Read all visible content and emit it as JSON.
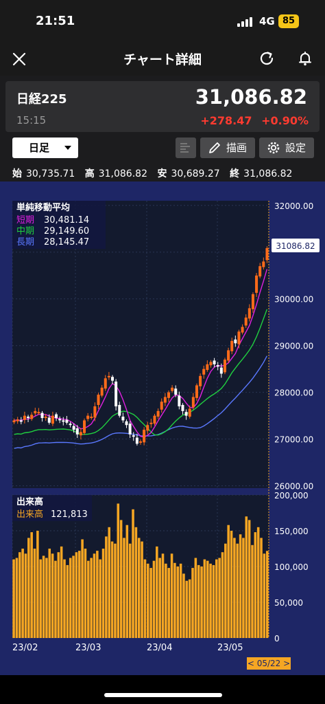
{
  "status_bar": {
    "time": "21:51",
    "network": "4G",
    "battery": "85"
  },
  "nav": {
    "title": "チャート詳細"
  },
  "quote": {
    "name": "日経225",
    "time": "15:15",
    "price": "31,086.82",
    "change": "+278.47",
    "change_pct": "+0.90%"
  },
  "controls": {
    "period": "日足",
    "draw_label": "描画",
    "settings_label": "設定"
  },
  "ohlc": {
    "open_label": "始",
    "open": "30,735.71",
    "high_label": "高",
    "high": "31,086.82",
    "low_label": "安",
    "low": "30,689.27",
    "close_label": "終",
    "close": "31,086.82"
  },
  "sma_legend": {
    "title": "単純移動平均",
    "short_label": "短期",
    "short_value": "30,481.14",
    "mid_label": "中期",
    "mid_value": "29,149.60",
    "long_label": "長期",
    "long_value": "28,145.47"
  },
  "volume_legend": {
    "title": "出来高",
    "label": "出来高",
    "value": "121,813"
  },
  "colors": {
    "up": "#ff6b1a",
    "down": "#ffffff",
    "short": "#e020e0",
    "mid": "#20d040",
    "long": "#5a78ff",
    "volume": "#f5a623",
    "chart_bg": "#1e2666",
    "last_price_tag": "#f5a623"
  },
  "chart_data": [
    {
      "type": "candlestick",
      "title": "",
      "x_ticks": [
        "23/02",
        "23/03",
        "23/04",
        "23/05"
      ],
      "y_ticks": [
        32000,
        31000,
        30000,
        29000,
        28000,
        27000,
        26000
      ],
      "y_tick_labels": [
        "32000.00",
        "",
        "30000.00",
        "29000.00",
        "28000.00",
        "27000.00",
        "26000.00"
      ],
      "ylim": [
        25950,
        32100
      ],
      "last_price_label": "31086.82",
      "cursor_date_label": "< 05/22 >",
      "closes": [
        27400,
        27420,
        27380,
        27500,
        27450,
        27520,
        27600,
        27580,
        27450,
        27480,
        27350,
        27500,
        27450,
        27420,
        27380,
        27350,
        27300,
        27200,
        27100,
        27150,
        27400,
        27500,
        27480,
        27700,
        27950,
        28100,
        28300,
        28350,
        28250,
        27700,
        27500,
        27400,
        27300,
        27100,
        27050,
        26900,
        26950,
        27200,
        27300,
        27350,
        27500,
        27600,
        27800,
        27900,
        28000,
        28100,
        27950,
        27700,
        27600,
        27500,
        27650,
        27900,
        28150,
        28350,
        28500,
        28600,
        28650,
        28600,
        28550,
        28400,
        28700,
        28900,
        29100,
        29050,
        29300,
        29400,
        29600,
        29800,
        30100,
        30500,
        30700,
        30800,
        31086
      ]
    },
    {
      "type": "bar",
      "title": "",
      "y_ticks": [
        200000,
        150000,
        100000,
        50000,
        0
      ],
      "y_tick_labels": [
        "200,000",
        "150,000",
        "100,000",
        "50,000",
        "0"
      ],
      "ylim": [
        0,
        200000
      ],
      "values": [
        110000,
        112000,
        120000,
        125000,
        118000,
        140000,
        148000,
        125000,
        150000,
        110000,
        115000,
        112000,
        125000,
        118000,
        108000,
        120000,
        128000,
        110000,
        102000,
        112000,
        115000,
        120000,
        122000,
        138000,
        125000,
        108000,
        112000,
        118000,
        122000,
        110000,
        125000,
        142000,
        155000,
        135000,
        132000,
        188000,
        165000,
        140000,
        158000,
        132000,
        180000,
        155000,
        140000,
        135000,
        110000,
        104000,
        98000,
        108000,
        128000,
        112000,
        118000,
        104000,
        98000,
        118000,
        105000,
        100000,
        104000,
        90000,
        80000,
        82000,
        98000,
        112000,
        102000,
        100000,
        110000,
        108000,
        104000,
        102000,
        110000,
        112000,
        120000,
        132000,
        158000,
        150000,
        140000,
        132000,
        145000,
        140000,
        170000,
        165000,
        130000,
        148000,
        155000,
        140000,
        118000,
        121813
      ]
    }
  ]
}
